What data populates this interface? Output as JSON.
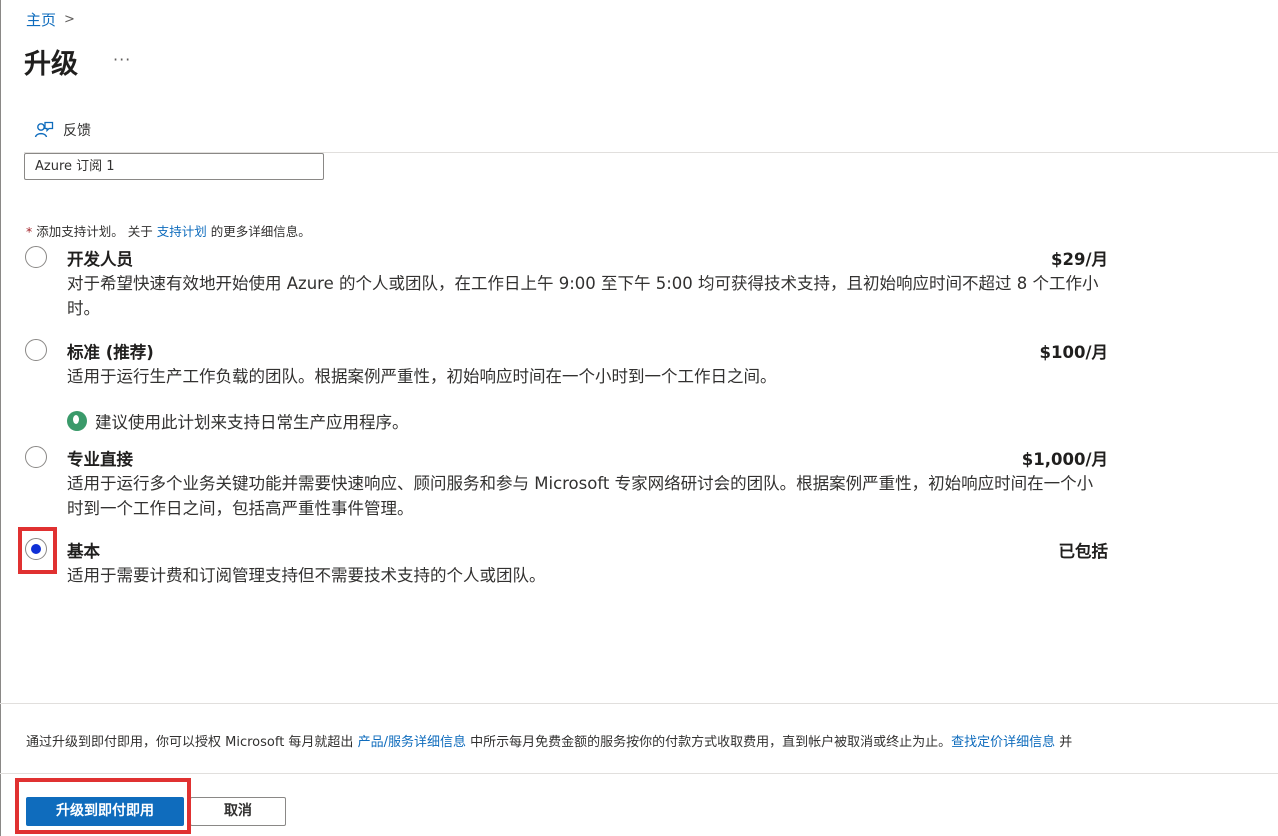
{
  "breadcrumb": {
    "home": "主页",
    "separator": ">"
  },
  "header": {
    "title": "升级",
    "more": "···"
  },
  "toolbar": {
    "feedback_label": "反馈"
  },
  "subscription": {
    "value": "Azure 订阅 1"
  },
  "plans_intro": {
    "required_mark": "*",
    "text_before": "添加支持计划。 关于",
    "link": "支持计划",
    "text_after": "的更多详细信息。"
  },
  "plans": [
    {
      "name": "开发人员",
      "price": "$29/月",
      "description": "对于希望快速有效地开始使用 Azure 的个人或团队，在工作日上午 9:00 至下午 5:00 均可获得技术支持，且初始响应时间不超过 8 个工作小时。",
      "selected": false
    },
    {
      "name": "标准 (推荐)",
      "price": "$100/月",
      "description": "适用于运行生产工作负载的团队。根据案例严重性，初始响应时间在一个小时到一个工作日之间。",
      "note": "建议使用此计划来支持日常生产应用程序。",
      "selected": false
    },
    {
      "name": "专业直接",
      "price": "$1,000/月",
      "description": "适用于运行多个业务关键功能并需要快速响应、顾问服务和参与 Microsoft 专家网络研讨会的团队。根据案例严重性，初始响应时间在一个小时到一个工作日之间，包括高严重性事件管理。",
      "selected": false
    },
    {
      "name": "基本",
      "price": "已包括",
      "description": "适用于需要计费和订阅管理支持但不需要技术支持的个人或团队。",
      "selected": true
    }
  ],
  "footer": {
    "text_1": "通过升级到即付即用，你可以授权 Microsoft 每月就超出",
    "link_1": "产品/服务详细信息",
    "text_2": "中所示每月免费金额的服务按你的付款方式收取费用，直到帐户被取消或终止为止。",
    "link_2": "查找定价详细信息",
    "text_3": "并"
  },
  "actions": {
    "upgrade_label": "升级到即付即用",
    "cancel_label": "取消"
  },
  "colors": {
    "accent": "#0f6cbd",
    "highlight": "#e03131",
    "radio_selected": "#0f2fd6"
  }
}
